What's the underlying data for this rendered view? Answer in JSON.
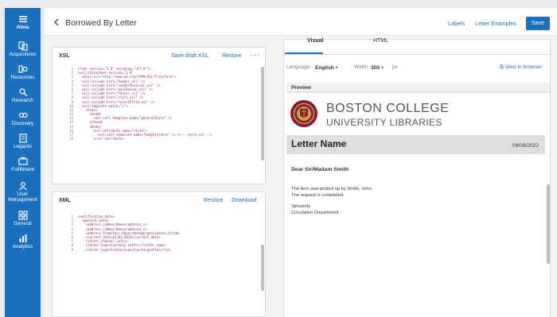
{
  "nav": [
    {
      "label": "Alma",
      "icon": "alma-menu-icon"
    },
    {
      "label": "Acquisitions",
      "icon": "acquisitions-icon"
    },
    {
      "label": "Resources",
      "icon": "resources-icon"
    },
    {
      "label": "Research",
      "icon": "research-icon"
    },
    {
      "label": "Discovery",
      "icon": "discovery-icon"
    },
    {
      "label": "Leganto",
      "icon": "leganto-icon"
    },
    {
      "label": "Fulfillment",
      "icon": "fulfillment-icon"
    },
    {
      "label": "User Management",
      "icon": "user-management-icon"
    },
    {
      "label": "General",
      "icon": "general-icon"
    },
    {
      "label": "Analytics",
      "icon": "analytics-icon"
    }
  ],
  "header": {
    "title": "Borrowed By Letter",
    "labels_link": "Labels",
    "examples_link": "Letter Examples",
    "save_label": "Save"
  },
  "xsl": {
    "title": "XSL",
    "save_draft": "Save draft XSL",
    "restore": "Restore",
    "more": "···",
    "lines": [
      "<?xml version=\"1.0\" encoding=\"utf-8\"?>",
      "<xsl:stylesheet version=\"1.0\"",
      "  xmlns:xsl=\"http://www.w3.org/1999/XSL/Transform\">",
      "  <xsl:include href=\"header.xsl\" />",
      "  <xsl:include href=\"senderReceiver.xsl\" />",
      "  <xsl:include href=\"mailReason.xsl\" />",
      "  <xsl:include href=\"footer.xsl\" />",
      "  <xsl:include href=\"style.xsl\" />",
      "  <xsl:include href=\"recordTitle.xsl\" />",
      "  <xsl:template match=\"/\">",
      "    <html>",
      "      <head>",
      "        <xsl:call-template name=\"generalStyle\" />",
      "      </head>",
      "      <body>",
      "        <xsl:attribute name=\"style\">",
      "          <xsl:call-template name=\"bodyStyleCss\" /> <!-- style.xsl -->",
      "        </xsl:attribute>"
    ]
  },
  "xml": {
    "title": "XML",
    "restore": "Restore",
    "download": "Download",
    "lines": [
      "<notification_data>",
      "  <general_data>",
      "    <address_c>None;None</address_c>",
      "    <address_c>None;None</address_c>",
      "    <address_from>Your.Department@organization.nfrom>",
      "    <current_date>16/01/2023</current_date>",
      "    <letter_channel_info/>",
      "    <letter_name>Courtesy Letter</letter_name>",
      "    <letter_type>FulUserLoansCourtesyLetter</let"
    ]
  },
  "preview": {
    "tab_visual": "Visual",
    "tab_html": "HTML",
    "language_label": "Language:",
    "language_value": "English",
    "width_label": "Width",
    "width_value": "300",
    "width_unit": "px",
    "view_in_browser": "View in browser",
    "section_title": "Preview",
    "org_line1": "BOSTON COLLEGE",
    "org_line2": "UNIVERSITY LIBRARIES",
    "letter_name": "Letter Name",
    "letter_date": "09/09/2022",
    "salutation": "Dear Sir/Madam   Smith",
    "body": [
      "The item was picked up by Smith, John",
      "The request is completed.",
      "Sincerely",
      "Circulation Department"
    ]
  },
  "colors": {
    "sidebar": "#1b6fbf",
    "accent": "#1b6fbf",
    "seal_maroon": "#8a1b2e"
  }
}
